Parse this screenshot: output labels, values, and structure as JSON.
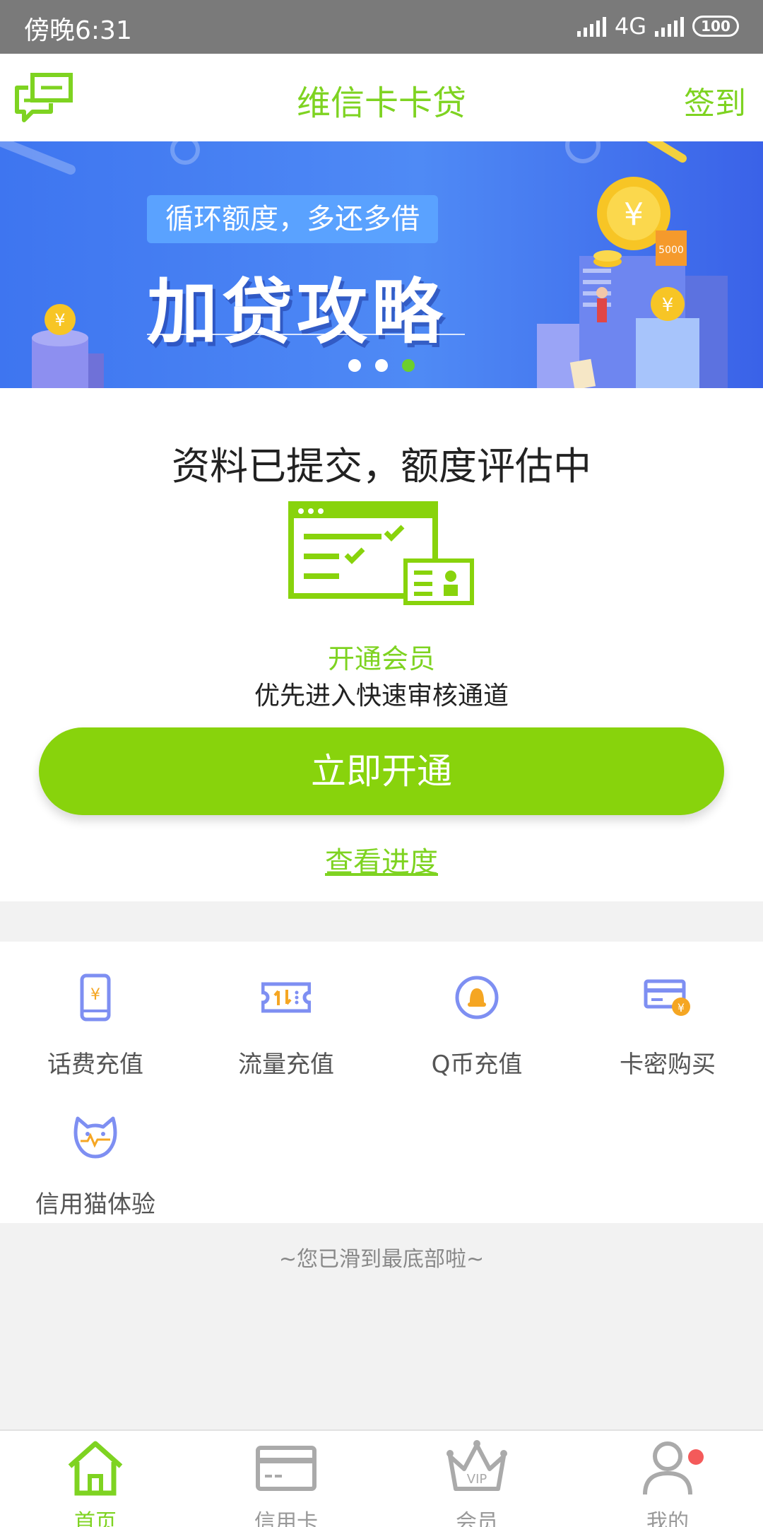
{
  "status_bar": {
    "time": "傍晚6:31",
    "network": "4G",
    "battery": "100"
  },
  "header": {
    "title": "维信卡卡贷",
    "signin": "签到"
  },
  "banner": {
    "subtitle": "循环额度，多还多借",
    "headline": "加贷攻略",
    "coin_label": "5000"
  },
  "status_card": {
    "title": "资料已提交，额度评估中",
    "member_label": "开通会员",
    "member_desc": "优先进入快速审核通道",
    "open_button": "立即开通",
    "progress_link": "查看进度"
  },
  "services": [
    {
      "label": "话费充值",
      "icon": "phone-recharge-icon"
    },
    {
      "label": "流量充值",
      "icon": "data-recharge-icon"
    },
    {
      "label": "Q币充值",
      "icon": "qq-coin-icon"
    },
    {
      "label": "卡密购买",
      "icon": "card-purchase-icon"
    },
    {
      "label": "信用猫体验",
      "icon": "credit-cat-icon"
    }
  ],
  "end_text": "~您已滑到最底部啦~",
  "bottom_nav": [
    {
      "label": "首页",
      "icon": "home-icon",
      "active": true
    },
    {
      "label": "信用卡",
      "icon": "credit-card-icon",
      "active": false
    },
    {
      "label": "会员",
      "icon": "vip-crown-icon",
      "active": false,
      "icon_text": "VIP"
    },
    {
      "label": "我的",
      "icon": "profile-icon",
      "active": false
    }
  ],
  "colors": {
    "accent": "#7ed321",
    "button": "#88d30c",
    "banner": "#4a7df2",
    "service_icon": "#7e8ff2",
    "badge": "#f45a5a"
  }
}
